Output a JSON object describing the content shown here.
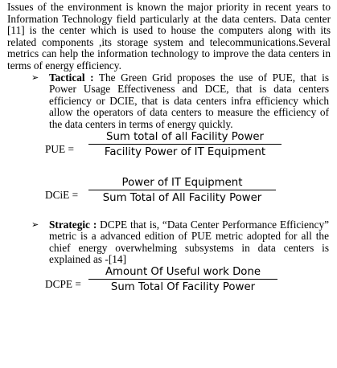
{
  "intro_paragraph": "Issues of the environment is known the major priority in recent years to Information Technology  field particularly at the data centers. Data center [11] is the center which is used to house the computers along with its related components ,its storage system and telecommunications.Several metrics can help the information technology to improve the data centers in terms of energy efficiency.",
  "bullets": [
    {
      "term": "Tactical  :",
      "text": " The Green Grid proposes the use of PUE, that is Power Usage Effectiveness and DCE, that is data centers efficiency or DCIE, that is data centers infra efficiency which allow the operators of data centers to measure the efficiency of the data centers in terms of energy quickly."
    },
    {
      "term": "Strategic :",
      "text": " DCPE that is, “Data Center Performance Efficiency” metric is a advanced edition of PUE metric adopted for all the chief energy overwhelming subsystems in data centers is explained as -[14]"
    }
  ],
  "formulas": {
    "pue": {
      "lhs": "PUE  =",
      "numerator": "Sum total of all Facility Power",
      "denominator": "Facility Power of IT Equipment"
    },
    "dcie": {
      "lhs": "DCiE  =",
      "numerator": "Power of IT Equipment",
      "denominator": "Sum Total of All Facility Power"
    },
    "dcpe": {
      "lhs": "DCPE  =",
      "numerator": "Amount Of Useful work Done",
      "denominator": "Sum Total Of Facility Power"
    }
  },
  "icons": {
    "bullet": "arrow-bullet-icon"
  }
}
